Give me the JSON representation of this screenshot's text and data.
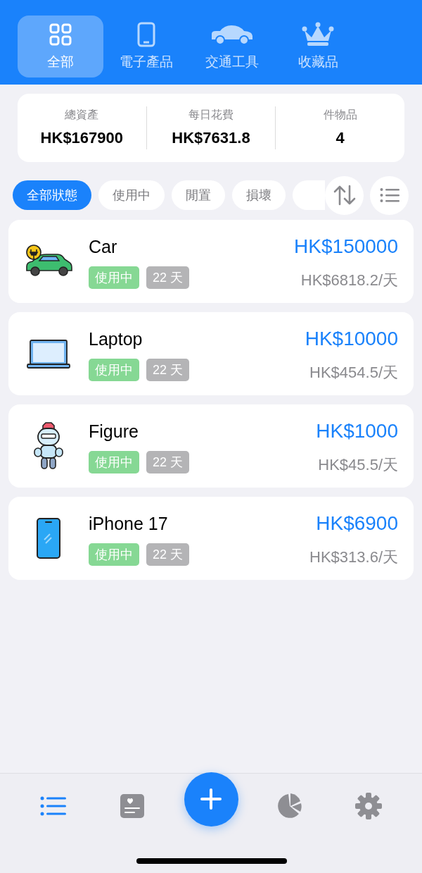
{
  "category_tabs": [
    {
      "label": "全部",
      "selected": true
    },
    {
      "label": "電子產品",
      "selected": false
    },
    {
      "label": "交通工具",
      "selected": false
    },
    {
      "label": "收藏品",
      "selected": false
    }
  ],
  "summary": [
    {
      "label": "總資產",
      "value": "HK$167900"
    },
    {
      "label": "每日花費",
      "value": "HK$7631.8"
    },
    {
      "label": "件物品",
      "value": "4"
    }
  ],
  "status_filters": [
    {
      "label": "全部狀態",
      "selected": true
    },
    {
      "label": "使用中",
      "selected": false
    },
    {
      "label": "閒置",
      "selected": false
    },
    {
      "label": "損壞",
      "selected": false
    }
  ],
  "items": [
    {
      "name": "Car",
      "status": "使用中",
      "days": "22 天",
      "price": "HK$150000",
      "daily": "HK$6818.2",
      "per": "/天"
    },
    {
      "name": "Laptop",
      "status": "使用中",
      "days": "22 天",
      "price": "HK$10000",
      "daily": "HK$454.5",
      "per": "/天"
    },
    {
      "name": "Figure",
      "status": "使用中",
      "days": "22 天",
      "price": "HK$1000",
      "daily": "HK$45.5",
      "per": "/天"
    },
    {
      "name": "iPhone 17",
      "status": "使用中",
      "days": "22 天",
      "price": "HK$6900",
      "daily": "HK$313.6",
      "per": "/天"
    }
  ],
  "bottom_nav": [
    {
      "kind": "tab",
      "selected": true
    },
    {
      "kind": "tab",
      "selected": false
    },
    {
      "kind": "add"
    },
    {
      "kind": "tab",
      "selected": false
    },
    {
      "kind": "tab",
      "selected": false
    }
  ]
}
